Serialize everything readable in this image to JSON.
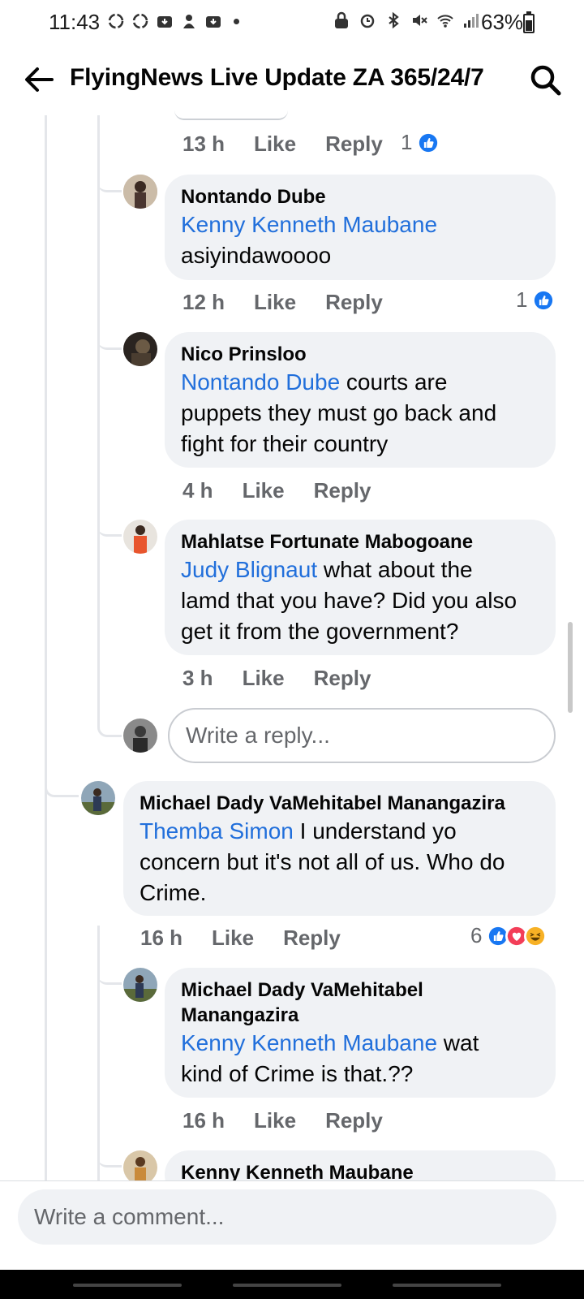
{
  "status_bar": {
    "time": "11:43",
    "battery": "63%"
  },
  "header": {
    "title": "FlyingNews Live Update ZA 365/24/7"
  },
  "comments": [
    {
      "time": "13 h",
      "like": "Like",
      "reply": "Reply",
      "reaction_count": "1"
    },
    {
      "author": "Nontando Dube",
      "mention": "Kenny Kenneth Maubane",
      "text": "asiyindawoooo",
      "time": "12 h",
      "like": "Like",
      "reply": "Reply",
      "reaction_count": "1"
    },
    {
      "author": "Nico Prinsloo",
      "mention": "Nontando Dube",
      "text_l1": " courts are",
      "text_l2": "puppets they must go back and",
      "text_l3": "fight for their country",
      "time": "4 h",
      "like": "Like",
      "reply": "Reply"
    },
    {
      "author": "Mahlatse Fortunate Mabogoane",
      "mention": "Judy Blignaut",
      "text_l1": " what about the",
      "text_l2": "lamd that you have? Did you also",
      "text_l3": "get it from the government?",
      "time": "3 h",
      "like": "Like",
      "reply": "Reply"
    },
    {
      "author": "Michael Dady VaMehitabel Manangazira",
      "mention": "Themba Simon",
      "text_l1": " I understand yo",
      "text_l2": "concern but it's not all of us. Who do",
      "text_l3": "Crime.",
      "time": "16 h",
      "like": "Like",
      "reply": "Reply",
      "reaction_count": "6"
    },
    {
      "author_l1": "Michael Dady VaMehitabel",
      "author_l2": "Manangazira",
      "mention": "Kenny Kenneth Maubane",
      "text_l1": " wat",
      "text_l2": "kind of Crime is that.??",
      "time": "16 h",
      "like": "Like",
      "reply": "Reply"
    },
    {
      "author": "Kenny Kenneth Maubane"
    }
  ],
  "reply_box": {
    "placeholder": "Write a reply..."
  },
  "comment_box": {
    "placeholder": "Write a comment..."
  },
  "colors": {
    "link": "#216fdb",
    "like_blue": "#1877f2",
    "love_red": "#f33e58",
    "haha_yellow": "#f7b125",
    "bubble": "#f0f2f5"
  }
}
